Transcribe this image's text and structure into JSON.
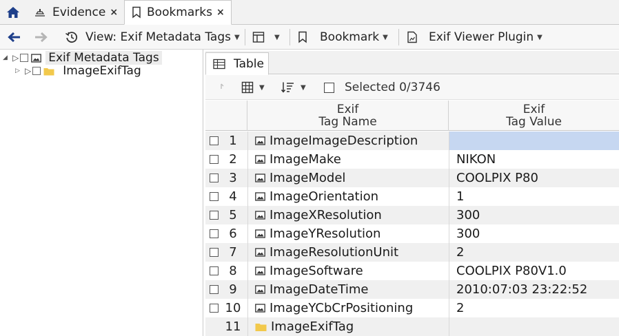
{
  "tabs": [
    {
      "label": "Evidence",
      "icon": "evidence-icon"
    },
    {
      "label": "Bookmarks",
      "icon": "bookmark-icon",
      "active": true
    }
  ],
  "tab_close_glyph": "×",
  "toolbar": {
    "view_label": "View: Exif Metadata Tags",
    "bookmark_label": "Bookmark",
    "plugin_label": "Exif Viewer Plugin"
  },
  "tree": {
    "root_label": "Exif Metadata Tags",
    "child_label": "ImageExifTag"
  },
  "panel": {
    "tab_label": "Table",
    "selected_label": "Selected 0/3746"
  },
  "table": {
    "header_name_line1": "Exif",
    "header_name_line2": "Tag Name",
    "header_value_line1": "Exif",
    "header_value_line2": "Tag Value",
    "rows": [
      {
        "num": "1",
        "name": "ImageImageDescription",
        "value": "",
        "type": "image"
      },
      {
        "num": "2",
        "name": "ImageMake",
        "value": "NIKON",
        "type": "image"
      },
      {
        "num": "3",
        "name": "ImageModel",
        "value": "COOLPIX P80",
        "type": "image"
      },
      {
        "num": "4",
        "name": "ImageOrientation",
        "value": "1",
        "type": "image"
      },
      {
        "num": "5",
        "name": "ImageXResolution",
        "value": "300",
        "type": "image"
      },
      {
        "num": "6",
        "name": "ImageYResolution",
        "value": "300",
        "type": "image"
      },
      {
        "num": "7",
        "name": "ImageResolutionUnit",
        "value": "2",
        "type": "image"
      },
      {
        "num": "8",
        "name": "ImageSoftware",
        "value": "COOLPIX P80V1.0",
        "type": "image"
      },
      {
        "num": "9",
        "name": "ImageDateTime",
        "value": "2010:07:03 23:22:52",
        "type": "image"
      },
      {
        "num": "10",
        "name": "ImageYCbCrPositioning",
        "value": "2",
        "type": "image"
      },
      {
        "num": "11",
        "name": "ImageExifTag",
        "value": "",
        "type": "folder"
      }
    ]
  },
  "colors": {
    "accent_blue": "#1e3f8a",
    "selection": "#c6d7f1",
    "folder": "#f2c94c"
  }
}
